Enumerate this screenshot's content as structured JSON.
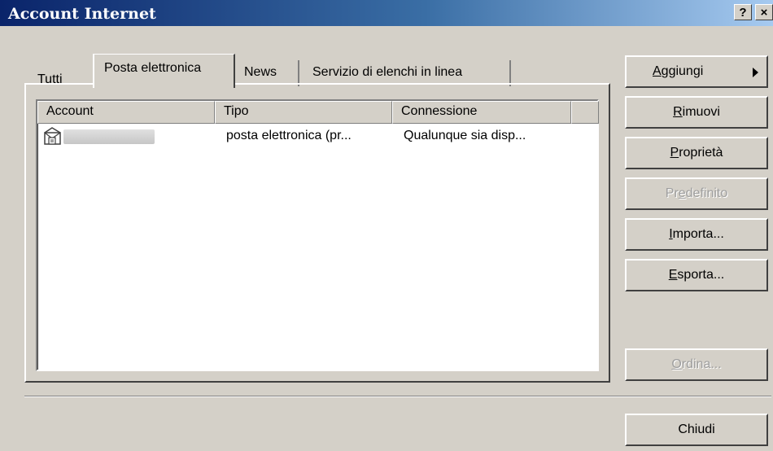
{
  "window": {
    "title": "Account Internet",
    "help_label": "?",
    "close_label": "×"
  },
  "tabs": [
    {
      "label": "Tutti"
    },
    {
      "label": "Posta elettronica"
    },
    {
      "label": "News"
    },
    {
      "label": "Servizio di elenchi in linea"
    }
  ],
  "active_tab": "Posta elettronica",
  "list": {
    "columns": [
      "Account",
      "Tipo",
      "Connessione"
    ],
    "rows": [
      {
        "account": "",
        "type": "posta elettronica (pr...",
        "connection": "Qualunque sia disp...",
        "icon": "mail-account-icon"
      }
    ]
  },
  "buttons": {
    "add": {
      "pre": "",
      "accel": "A",
      "rest": "ggiungi",
      "enabled": true
    },
    "remove": {
      "pre": "",
      "accel": "R",
      "rest": "imuovi",
      "enabled": true
    },
    "properties": {
      "pre": "",
      "accel": "P",
      "rest": "roprietà",
      "enabled": true
    },
    "default": {
      "pre": "Pr",
      "accel": "e",
      "rest": "definito",
      "enabled": false
    },
    "import": {
      "pre": "",
      "accel": "I",
      "rest": "mporta...",
      "enabled": true
    },
    "export": {
      "pre": "",
      "accel": "E",
      "rest": "sporta...",
      "enabled": true
    },
    "order": {
      "pre": "",
      "accel": "O",
      "rest": "rdina...",
      "enabled": false
    },
    "close": {
      "label": "Chiudi",
      "enabled": true
    }
  },
  "colors": {
    "titlebar_start": "#0a246a",
    "titlebar_end": "#a6caf0",
    "face": "#d4d0c8"
  }
}
